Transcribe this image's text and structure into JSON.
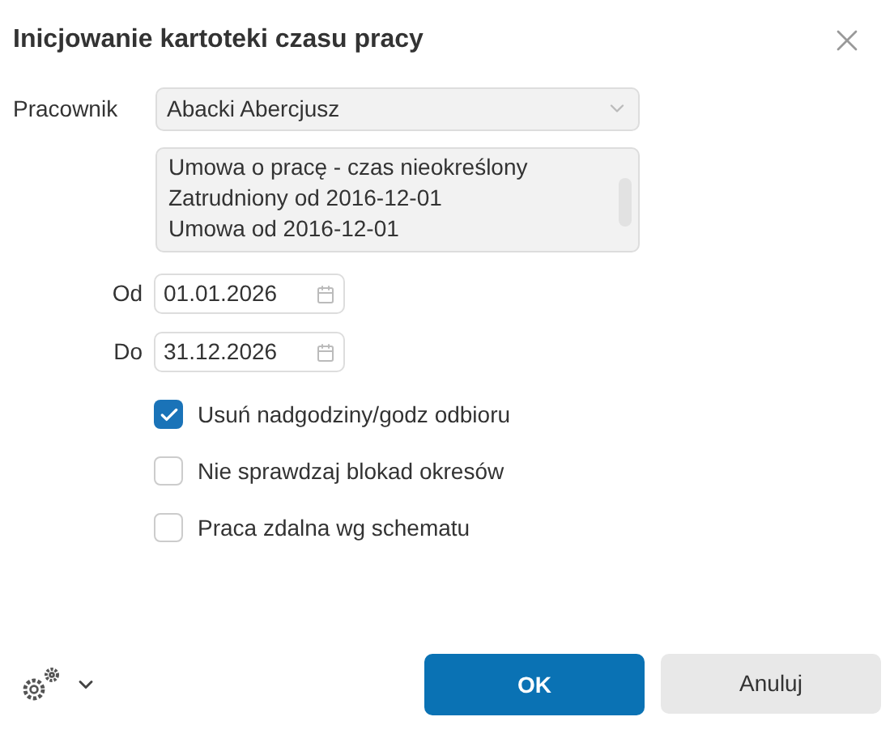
{
  "window": {
    "title": "Inicjowanie kartoteki czasu pracy"
  },
  "employee": {
    "label": "Pracownik",
    "value": "Abacki Abercjusz"
  },
  "contract_info": [
    "Umowa o pracę - czas nieokreślony",
    "Zatrudniony od 2016-12-01",
    "Umowa od 2016-12-01"
  ],
  "dates": [
    {
      "label": "Od",
      "value": "01.01.2026"
    },
    {
      "label": "Do",
      "value": "31.12.2026"
    }
  ],
  "options": [
    {
      "label": "Usuń nadgodziny/godz odbioru",
      "checked": true
    },
    {
      "label": "Nie sprawdzaj blokad okresów",
      "checked": false
    },
    {
      "label": "Praca zdalna wg schematu",
      "checked": false
    }
  ],
  "buttons": [
    {
      "label": "OK",
      "kind": "primary"
    },
    {
      "label": "Anuluj",
      "kind": "secondary"
    }
  ]
}
